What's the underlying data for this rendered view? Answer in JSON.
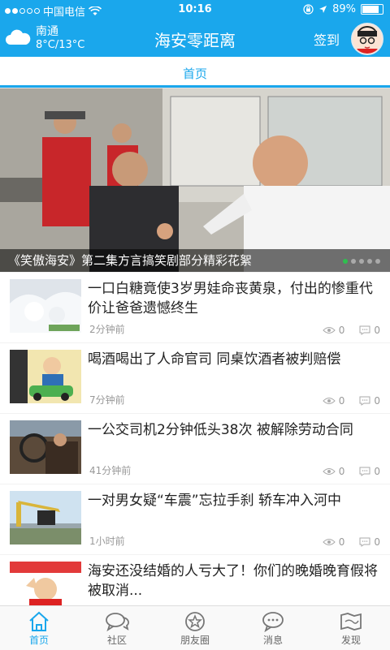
{
  "status": {
    "carrier": "中国电信",
    "time": "10:16",
    "battery": "89%",
    "battery_level": 0.89
  },
  "header": {
    "city": "南通",
    "temperature": "8°C/13°C",
    "title": "海安零距离",
    "signin": "签到"
  },
  "tabs": [
    {
      "label": "首页"
    }
  ],
  "banner": {
    "caption": "《笑傲海安》第二集方言搞笑剧部分精彩花絮",
    "pages": 5,
    "current_page": 1
  },
  "news": [
    {
      "headline": "一口白糖竟使3岁男娃命丧黄泉，付出的惨重代价让爸爸遗憾终生",
      "time": "2分钟前",
      "views": "0",
      "comments": "0"
    },
    {
      "headline": "喝酒喝出了人命官司 同桌饮酒者被判赔偿",
      "time": "7分钟前",
      "views": "0",
      "comments": "0"
    },
    {
      "headline": "一公交司机2分钟低头38次 被解除劳动合同",
      "time": "41分钟前",
      "views": "0",
      "comments": "0"
    },
    {
      "headline": "一对男女疑“车震”忘拉手刹 轿车冲入河中",
      "time": "1小时前",
      "views": "0",
      "comments": "0"
    },
    {
      "headline": "海安还没结婚的人亏大了！你们的晚婚晚育假将被取消...",
      "time": "",
      "views": "",
      "comments": ""
    }
  ],
  "bottom_nav": [
    {
      "label": "首页",
      "icon": "home-icon"
    },
    {
      "label": "社区",
      "icon": "community-icon"
    },
    {
      "label": "朋友圈",
      "icon": "moments-icon"
    },
    {
      "label": "消息",
      "icon": "message-icon"
    },
    {
      "label": "发现",
      "icon": "discover-icon"
    }
  ],
  "colors": {
    "accent": "#1aa7ec",
    "pager_active": "#2fbf4f"
  }
}
